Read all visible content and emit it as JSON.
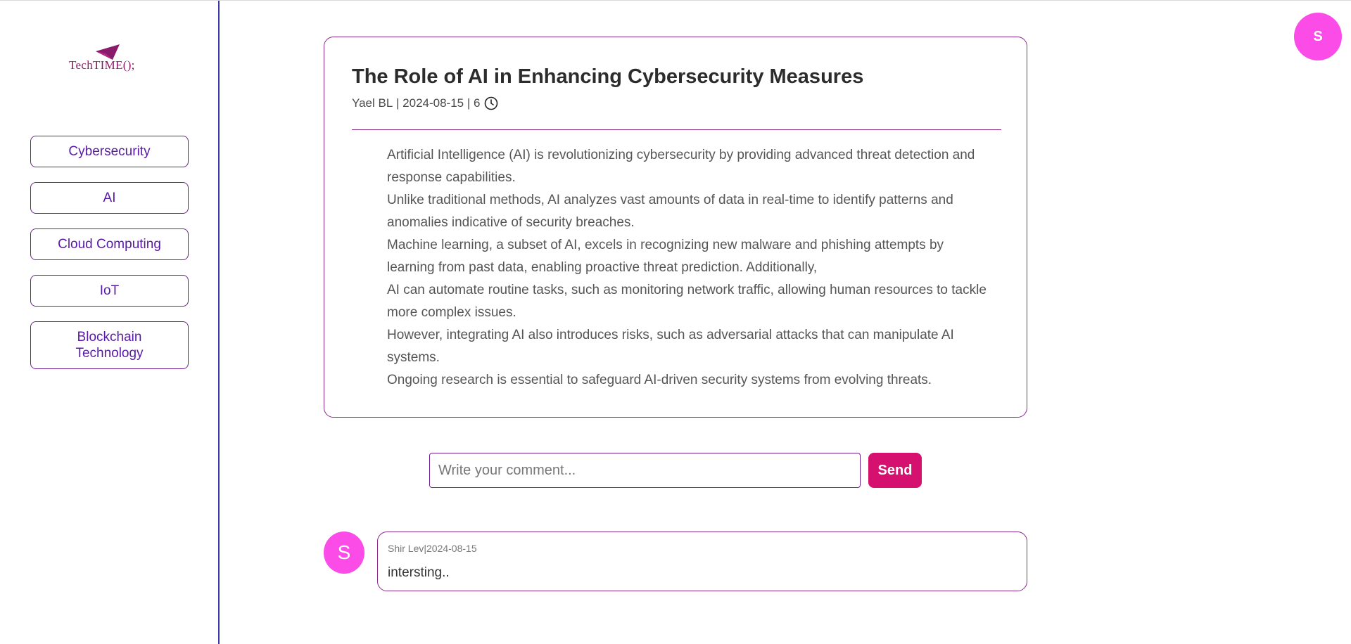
{
  "brand": {
    "logo_text": "TechTIME();",
    "logo_color": "#8a1a6a"
  },
  "sidebar": {
    "items": [
      {
        "label": "Cybersecurity"
      },
      {
        "label": "AI"
      },
      {
        "label": "Cloud Computing"
      },
      {
        "label": "IoT"
      },
      {
        "label": "Blockchain Technology"
      }
    ]
  },
  "user": {
    "avatar_initial": "S",
    "avatar_color": "#fb4ce8"
  },
  "article": {
    "title": "The Role of AI in Enhancing Cybersecurity Measures",
    "author": "Yael BL",
    "date": "2024-08-15",
    "read_time": "6",
    "meta_separator": " | ",
    "read_time_icon": "clock-icon",
    "paragraphs": [
      "Artificial Intelligence (AI) is revolutionizing cybersecurity by providing advanced threat detection and response capabilities.",
      "Unlike traditional methods, AI analyzes vast amounts of data in real-time to identify patterns and anomalies indicative of security breaches.",
      "Machine learning, a subset of AI, excels in recognizing new malware and phishing attempts by learning from past data, enabling proactive threat prediction. Additionally,",
      "AI can automate routine tasks, such as monitoring network traffic, allowing human resources to tackle more complex issues.",
      "However, integrating AI also introduces risks, such as adversarial attacks that can manipulate AI systems.",
      "Ongoing research is essential to safeguard AI-driven security systems from evolving threats."
    ]
  },
  "comment_form": {
    "placeholder": "Write your comment...",
    "value": "",
    "send_label": "Send",
    "send_color": "#d6106f"
  },
  "comments": [
    {
      "avatar_initial": "S",
      "author": "Shir Lev",
      "date": "2024-08-15",
      "separator": "|",
      "text": "intersting.."
    }
  ],
  "colors": {
    "accent_border": "#8a2a8a",
    "nav_text": "#5a1aa8",
    "sidebar_divider": "#3b3ba8"
  }
}
